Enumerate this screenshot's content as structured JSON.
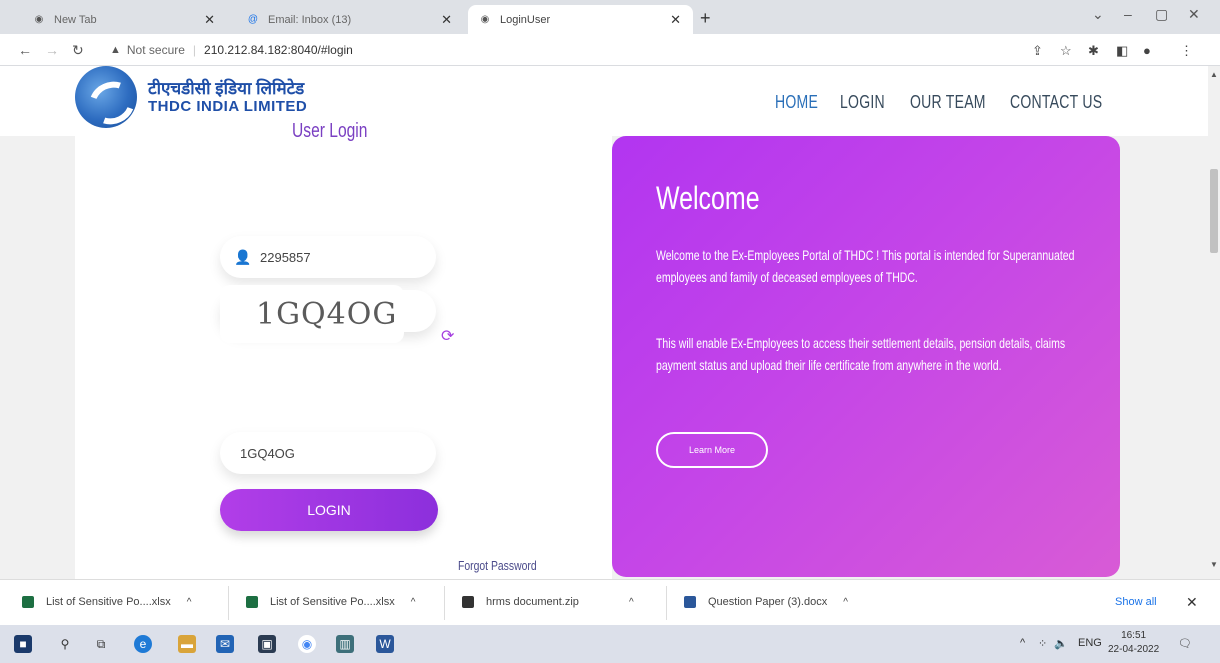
{
  "browser": {
    "tabs": [
      {
        "title": "New Tab",
        "active": false
      },
      {
        "title": "Email: Inbox (13)",
        "active": false
      },
      {
        "title": "LoginUser",
        "active": true
      }
    ],
    "address": {
      "security": "Not secure",
      "url": "210.212.84.182:8040/#login"
    }
  },
  "site": {
    "logo_hindi": "टीएचडीसी इंडिया लिमिटेड",
    "logo_english": "THDC INDIA LIMITED",
    "nav": [
      "HOME",
      "LOGIN",
      "OUR TEAM",
      "CONTACT US"
    ],
    "nav_active": "HOME"
  },
  "login": {
    "title": "User Login",
    "username": "2295857",
    "password_mask": "••••••••",
    "captcha_text": "1GQ4OG",
    "captcha_input": "1GQ4OG",
    "button": "LOGIN",
    "forgot": "Forgot Password"
  },
  "welcome": {
    "heading": "Welcome",
    "para1": "Welcome to the Ex-Employees Portal of THDC ! This portal is intended for Superannuated employees and family of deceased employees of THDC.",
    "para2": "This will enable Ex-Employees to access their settlement details, pension details, claims payment status and upload their life certificate from anywhere in the world.",
    "button": "Learn More"
  },
  "downloads": {
    "items": [
      "List of Sensitive Po....xlsx",
      "List of Sensitive Po....xlsx",
      "hrms document.zip",
      "Question Paper (3).docx"
    ],
    "show_all": "Show all"
  },
  "taskbar": {
    "lang": "ENG",
    "time": "16:51",
    "date": "22-04-2022"
  },
  "colors": {
    "accent": "#a53fdf",
    "welcome_gradient": [
      "#b235f0",
      "#d85bd6"
    ],
    "nav": "#374a5c"
  }
}
